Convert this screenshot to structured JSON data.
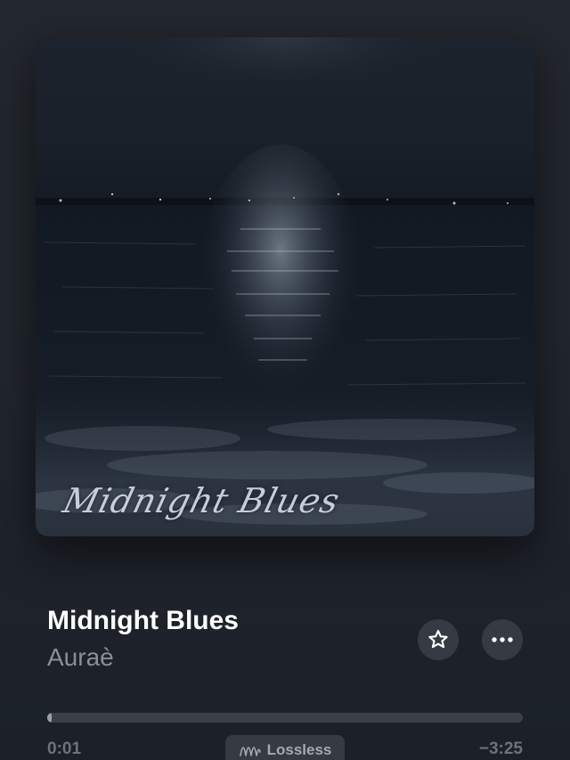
{
  "artwork": {
    "title_script": "Midnight Blues"
  },
  "track": {
    "title": "Midnight Blues",
    "artist": "Auraè"
  },
  "actions": {
    "favorite_icon": "star-icon",
    "more_icon": "ellipsis-icon"
  },
  "playback": {
    "elapsed": "0:01",
    "remaining": "−3:25",
    "progress_fraction": 0.005
  },
  "quality": {
    "icon": "lossless-wave-icon",
    "label": "Lossless"
  },
  "colors": {
    "background": "#22272e",
    "title": "#ffffff",
    "artist": "#8a8f98",
    "button_bg": "#353a43",
    "progress_track": "#3b4048",
    "progress_fill": "#9aa0a8",
    "time_text": "#6d727b"
  }
}
